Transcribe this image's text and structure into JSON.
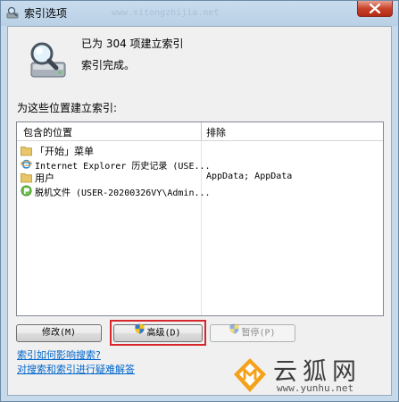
{
  "window": {
    "title": "索引选项",
    "background_watermark": "www.xitongzhijia.net"
  },
  "status": {
    "count_text": "已为 304 项建立索引",
    "state_text": "索引完成。"
  },
  "locations": {
    "section_label": "为这些位置建立索引:",
    "columns": {
      "included": "包含的位置",
      "exclude": "排除"
    },
    "rows": [
      {
        "icon": "folder-icon",
        "name": "「开始」菜单",
        "exclude": ""
      },
      {
        "icon": "internet-explorer-icon",
        "name": "Internet Explorer 历史记录 (USE...",
        "exclude": ""
      },
      {
        "icon": "folder-icon",
        "name": "用户",
        "exclude": "AppData; AppData"
      },
      {
        "icon": "offline-files-icon",
        "name": "脱机文件 (USER-20200326VY\\Admin...",
        "exclude": ""
      }
    ]
  },
  "buttons": {
    "modify": "修改(M)",
    "advanced": "高级(D)",
    "pause": "暂停(P)"
  },
  "links": {
    "how_indexing_affects": "索引如何影响搜索?",
    "troubleshoot": "对搜索和索引进行疑难解答"
  },
  "watermark": {
    "brand": "云狐网",
    "url": "www.yunhu.net"
  },
  "colors": {
    "link": "#0066cc",
    "highlight_outline": "#d8262b",
    "folder": "#e8c66a"
  }
}
